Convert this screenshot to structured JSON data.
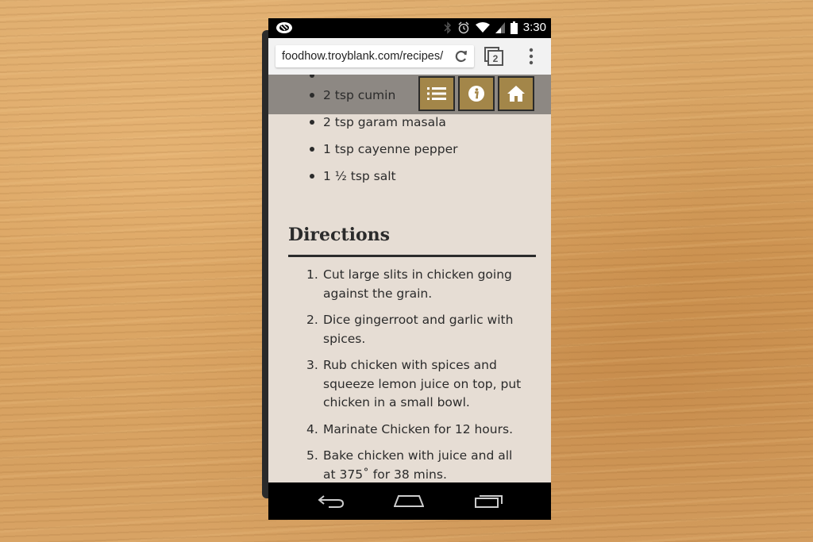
{
  "browser": {
    "url": "foodhow.troyblank.com/recipes/"
  },
  "status_bar": {
    "time": "3:30",
    "icons": [
      "bluetooth-icon",
      "alarm-icon",
      "wifi-icon",
      "signal-icon",
      "battery-icon"
    ],
    "tab_count": "2"
  },
  "ingredients": {
    "items": [
      "2 tsp cumin",
      "2 tsp garam masala",
      "1 tsp cayenne pepper",
      "1 ½ tsp salt"
    ]
  },
  "toolbar": {
    "icons": [
      "list-icon",
      "info-icon",
      "home-icon"
    ],
    "accent": "#a38649"
  },
  "directions": {
    "title": "Directions",
    "steps": [
      {
        "num": "1.",
        "text": "Cut large slits in chicken going against the grain."
      },
      {
        "num": "2.",
        "text": "Dice gingerroot and garlic with spices."
      },
      {
        "num": "3.",
        "text": "Rub chicken with spices and squeeze lemon juice on top, put chicken in a small bowl."
      },
      {
        "num": "4.",
        "text": "Marinate Chicken for 12 hours."
      },
      {
        "num": "5.",
        "text": "Bake chicken with juice and all at 375˚ for 38 mins."
      }
    ]
  },
  "colors": {
    "content_bg": "#e6ddd4",
    "text": "#2b2b2b"
  }
}
